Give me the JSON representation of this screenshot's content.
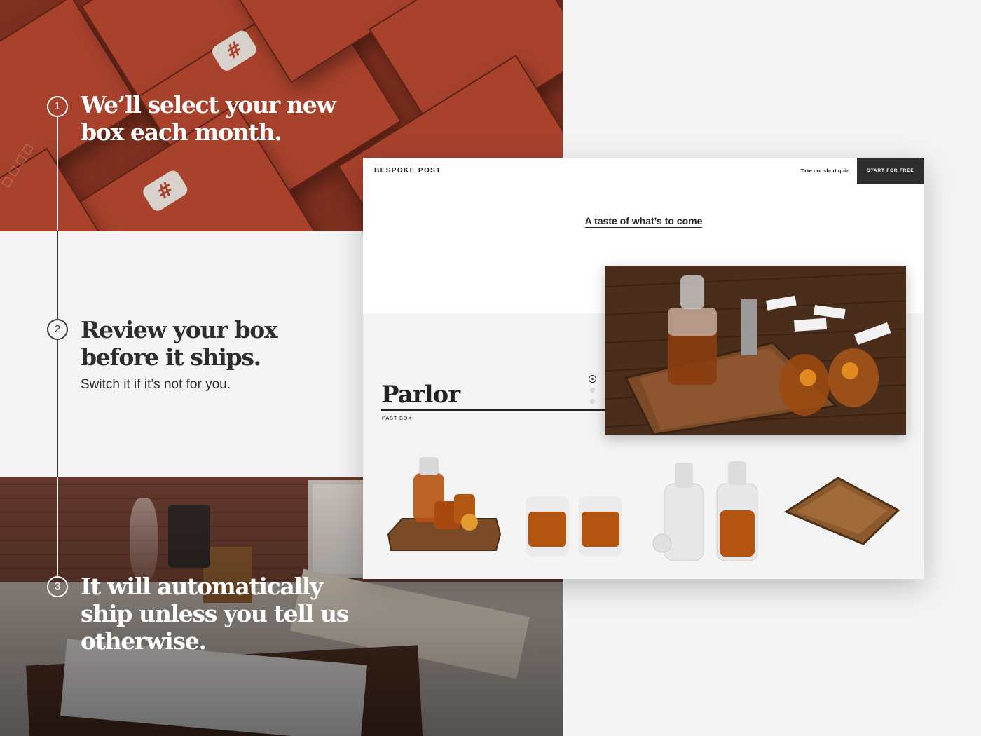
{
  "steps": [
    {
      "number": "1",
      "title_line1": "We’ll select your new",
      "title_line2": "box each month."
    },
    {
      "number": "2",
      "title_line1": "Review your box",
      "title_line2": "before it ships.",
      "subtitle": "Switch it if it’s not for you."
    },
    {
      "number": "3",
      "title_line1": "It will automatically",
      "title_line2": "ship unless you tell us",
      "title_line3": "otherwise."
    }
  ],
  "site": {
    "brand": "BESPOKE POST",
    "nav_link": "Take our short quiz",
    "cta": "START FOR FREE",
    "tagline": "A taste of what’s to come",
    "box_name": "Parlor",
    "box_label": "PAST BOX",
    "carousel": {
      "count": 3,
      "active_index": 0
    }
  },
  "colors": {
    "box_red": "#a8422d",
    "ink": "#222222",
    "background": "#f4f4f4",
    "cta_background": "#2d2d2d"
  }
}
